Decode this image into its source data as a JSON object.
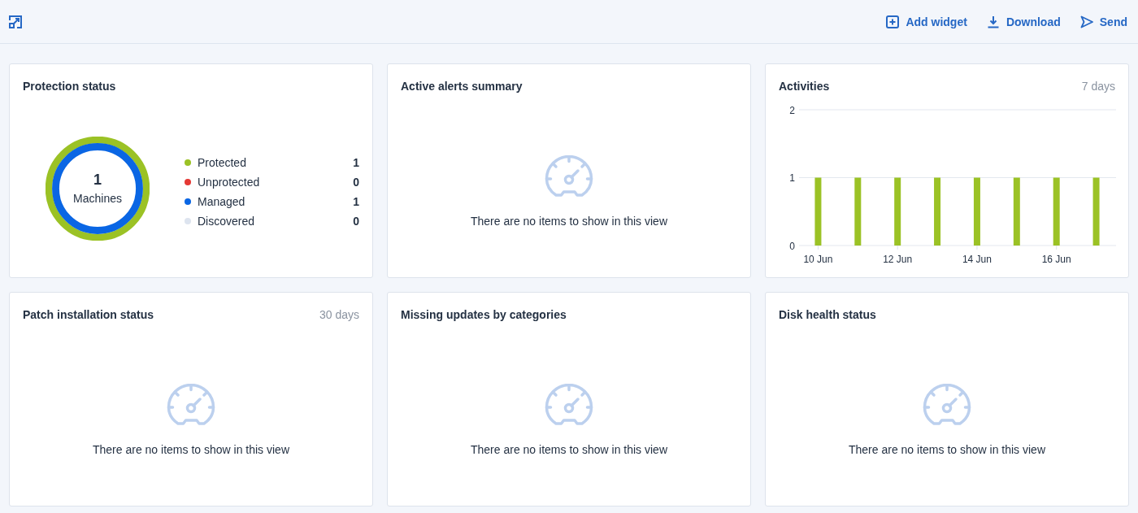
{
  "toolbar": {
    "actions": [
      {
        "kind": "add",
        "label": "Add widget"
      },
      {
        "kind": "download",
        "label": "Download"
      },
      {
        "kind": "send",
        "label": "Send"
      }
    ]
  },
  "widgets": [
    {
      "kind": "donut",
      "title": "Protection status",
      "total": "1",
      "total_label": "Machines",
      "legend": [
        {
          "label": "Protected",
          "count": "1",
          "color": "#9bc225"
        },
        {
          "label": "Unprotected",
          "count": "0",
          "color": "#e53935"
        },
        {
          "label": "Managed",
          "count": "1",
          "color": "#0a66e4"
        },
        {
          "label": "Discovered",
          "count": "0",
          "color": "#dde4ef"
        }
      ]
    },
    {
      "kind": "empty",
      "title": "Active alerts summary",
      "message": "There are no items to show in this view"
    },
    {
      "kind": "chart",
      "title": "Activities",
      "period": "7 days",
      "chart_data": {
        "type": "bar",
        "categories": [
          "10 Jun",
          null,
          "12 Jun",
          null,
          "14 Jun",
          null,
          "16 Jun",
          null
        ],
        "series": [
          {
            "color": "#9bc225",
            "values": [
              1,
              1,
              1,
              1,
              1,
              1,
              1,
              1
            ]
          }
        ],
        "ylim": [
          0,
          2
        ],
        "yticks": [
          0,
          1,
          2
        ]
      }
    },
    {
      "kind": "empty",
      "title": "Patch installation status",
      "period": "30 days",
      "message": "There are no items to show in this view"
    },
    {
      "kind": "empty",
      "title": "Missing updates by categories",
      "message": "There are no items to show in this view"
    },
    {
      "kind": "empty",
      "title": "Disk health status",
      "message": "There are no items to show in this view"
    }
  ]
}
